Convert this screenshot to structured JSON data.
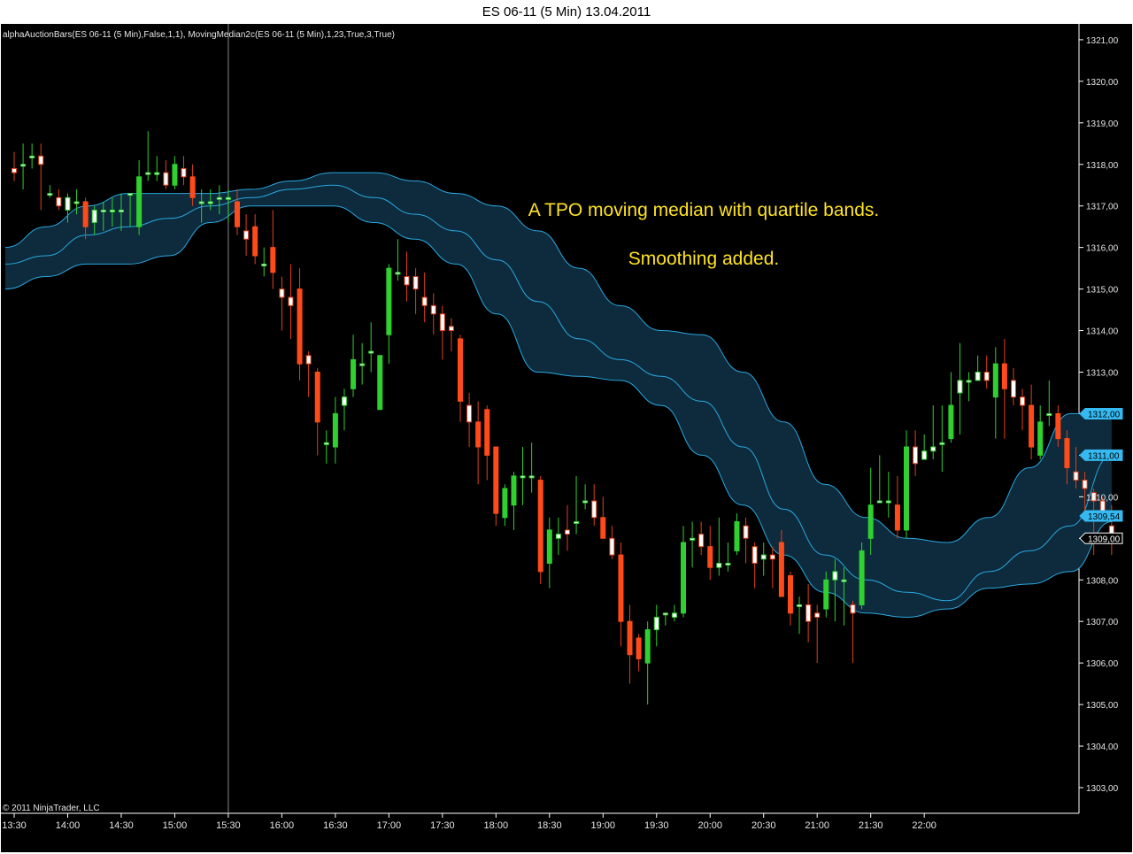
{
  "window": {
    "title": "ES 06-11 (5 Min)  13.04.2011"
  },
  "indicator_label": "alphaAuctionBars(ES 06-11 (5 Min),False,1,1), MovingMedian2c(ES 06-11 (5 Min),1,23,True,3,True)",
  "annotation": {
    "line1": "A TPO moving median with quartile bands.",
    "line2": "Smoothing added."
  },
  "copyright": "© 2011 NinjaTrader, LLC",
  "colors": {
    "background": "#000000",
    "band_fill": "#0d2b3c",
    "band_line": "#29a8e0",
    "up_bar": "#2fd02f",
    "down_bar": "#ff4a1a",
    "wick_up": "#2fd02f",
    "wick_down": "#e0401a",
    "text": "#e6e6e6",
    "annotation": "#ffe21f",
    "marker": "#35b9f0"
  },
  "chart_data": {
    "type": "candlestick",
    "x_ticks": [
      "13:30",
      "14:00",
      "14:30",
      "15:00",
      "15:30",
      "16:00",
      "16:30",
      "17:00",
      "17:30",
      "18:00",
      "18:30",
      "19:00",
      "19:30",
      "20:00",
      "20:30",
      "21:00",
      "21:30",
      "22:00"
    ],
    "y_ticks": [
      "1303,00",
      "1304,00",
      "1305,00",
      "1306,00",
      "1307,00",
      "1308,00",
      "1309,00",
      "1310,00",
      "1311,00",
      "1312,00",
      "1313,00",
      "1314,00",
      "1315,00",
      "1316,00",
      "1317,00",
      "1318,00",
      "1319,00",
      "1320,00",
      "1321,00"
    ],
    "y_tick_values": [
      1303,
      1304,
      1305,
      1306,
      1307,
      1308,
      1309,
      1310,
      1311,
      1312,
      1313,
      1314,
      1315,
      1316,
      1317,
      1318,
      1319,
      1320,
      1321
    ],
    "ylim": [
      1302.5,
      1321.2
    ],
    "bars_per_30min": 6,
    "candles": [
      {
        "o": 1317.9,
        "h": 1318.3,
        "l": 1317.6,
        "c": 1317.8
      },
      {
        "o": 1318.0,
        "h": 1318.5,
        "l": 1317.4,
        "c": 1318.0
      },
      {
        "o": 1318.2,
        "h": 1318.5,
        "l": 1317.9,
        "c": 1318.2
      },
      {
        "o": 1318.2,
        "h": 1318.5,
        "l": 1316.9,
        "c": 1318.0
      },
      {
        "o": 1317.3,
        "h": 1317.5,
        "l": 1317.2,
        "c": 1317.3
      },
      {
        "o": 1317.2,
        "h": 1317.4,
        "l": 1316.9,
        "c": 1317.0
      },
      {
        "o": 1316.9,
        "h": 1317.3,
        "l": 1316.6,
        "c": 1317.2
      },
      {
        "o": 1317.1,
        "h": 1317.4,
        "l": 1316.8,
        "c": 1317.1
      },
      {
        "o": 1317.1,
        "h": 1317.2,
        "l": 1316.2,
        "c": 1316.5
      },
      {
        "o": 1316.6,
        "h": 1317.0,
        "l": 1316.3,
        "c": 1316.9
      },
      {
        "o": 1316.9,
        "h": 1317.1,
        "l": 1316.4,
        "c": 1316.9
      },
      {
        "o": 1316.9,
        "h": 1317.2,
        "l": 1316.5,
        "c": 1316.9
      },
      {
        "o": 1316.9,
        "h": 1317.3,
        "l": 1316.4,
        "c": 1316.9
      },
      {
        "o": 1317.3,
        "h": 1317.3,
        "l": 1316.5,
        "c": 1317.3
      },
      {
        "o": 1316.5,
        "h": 1318.1,
        "l": 1316.3,
        "c": 1317.7
      },
      {
        "o": 1317.8,
        "h": 1318.8,
        "l": 1317.6,
        "c": 1317.8
      },
      {
        "o": 1317.8,
        "h": 1318.2,
        "l": 1317.6,
        "c": 1317.8
      },
      {
        "o": 1317.8,
        "h": 1318.1,
        "l": 1317.4,
        "c": 1317.5
      },
      {
        "o": 1317.5,
        "h": 1318.2,
        "l": 1317.4,
        "c": 1318.0
      },
      {
        "o": 1317.9,
        "h": 1318.2,
        "l": 1317.5,
        "c": 1317.7
      },
      {
        "o": 1317.7,
        "h": 1318.0,
        "l": 1317.0,
        "c": 1317.2
      },
      {
        "o": 1317.1,
        "h": 1317.4,
        "l": 1316.6,
        "c": 1317.1
      },
      {
        "o": 1317.1,
        "h": 1317.4,
        "l": 1316.9,
        "c": 1317.1
      },
      {
        "o": 1317.2,
        "h": 1317.5,
        "l": 1316.8,
        "c": 1317.2
      },
      {
        "o": 1317.2,
        "h": 1317.4,
        "l": 1316.6,
        "c": 1317.2
      },
      {
        "o": 1317.1,
        "h": 1317.4,
        "l": 1316.3,
        "c": 1316.5
      },
      {
        "o": 1316.4,
        "h": 1316.8,
        "l": 1315.8,
        "c": 1316.2
      },
      {
        "o": 1316.5,
        "h": 1316.8,
        "l": 1315.6,
        "c": 1315.8
      },
      {
        "o": 1315.6,
        "h": 1316.0,
        "l": 1315.3,
        "c": 1315.6
      },
      {
        "o": 1316.0,
        "h": 1316.9,
        "l": 1315.0,
        "c": 1315.4
      },
      {
        "o": 1315.0,
        "h": 1315.3,
        "l": 1314.0,
        "c": 1314.8
      },
      {
        "o": 1314.8,
        "h": 1315.6,
        "l": 1313.8,
        "c": 1314.6
      },
      {
        "o": 1315.0,
        "h": 1315.5,
        "l": 1312.8,
        "c": 1313.2
      },
      {
        "o": 1313.4,
        "h": 1313.5,
        "l": 1312.4,
        "c": 1313.2
      },
      {
        "o": 1313.0,
        "h": 1313.1,
        "l": 1311.0,
        "c": 1311.8
      },
      {
        "o": 1311.3,
        "h": 1311.6,
        "l": 1310.8,
        "c": 1311.3
      },
      {
        "o": 1311.2,
        "h": 1312.4,
        "l": 1310.8,
        "c": 1312.0
      },
      {
        "o": 1312.2,
        "h": 1312.6,
        "l": 1311.6,
        "c": 1312.4
      },
      {
        "o": 1312.6,
        "h": 1313.9,
        "l": 1312.4,
        "c": 1313.3
      },
      {
        "o": 1313.2,
        "h": 1313.7,
        "l": 1312.7,
        "c": 1313.2
      },
      {
        "o": 1313.5,
        "h": 1314.2,
        "l": 1313.0,
        "c": 1313.5
      },
      {
        "o": 1312.1,
        "h": 1313.4,
        "l": 1312.1,
        "c": 1313.4
      },
      {
        "o": 1313.9,
        "h": 1315.6,
        "l": 1313.2,
        "c": 1315.5
      },
      {
        "o": 1315.4,
        "h": 1316.2,
        "l": 1315.2,
        "c": 1315.4
      },
      {
        "o": 1315.3,
        "h": 1315.9,
        "l": 1314.7,
        "c": 1315.1
      },
      {
        "o": 1315.3,
        "h": 1315.5,
        "l": 1314.4,
        "c": 1315.0
      },
      {
        "o": 1314.8,
        "h": 1315.4,
        "l": 1314.2,
        "c": 1314.6
      },
      {
        "o": 1314.6,
        "h": 1314.9,
        "l": 1313.9,
        "c": 1314.4
      },
      {
        "o": 1314.4,
        "h": 1314.6,
        "l": 1313.3,
        "c": 1314.0
      },
      {
        "o": 1314.1,
        "h": 1314.3,
        "l": 1313.5,
        "c": 1314.0
      },
      {
        "o": 1313.8,
        "h": 1313.9,
        "l": 1311.8,
        "c": 1312.3
      },
      {
        "o": 1312.2,
        "h": 1312.5,
        "l": 1311.2,
        "c": 1311.8
      },
      {
        "o": 1311.8,
        "h": 1312.3,
        "l": 1310.3,
        "c": 1311.2
      },
      {
        "o": 1312.1,
        "h": 1312.2,
        "l": 1310.4,
        "c": 1311.0
      },
      {
        "o": 1311.2,
        "h": 1311.2,
        "l": 1309.3,
        "c": 1309.6
      },
      {
        "o": 1309.5,
        "h": 1310.3,
        "l": 1309.3,
        "c": 1310.2
      },
      {
        "o": 1309.8,
        "h": 1310.6,
        "l": 1309.2,
        "c": 1310.5
      },
      {
        "o": 1310.5,
        "h": 1311.2,
        "l": 1309.8,
        "c": 1310.5
      },
      {
        "o": 1310.5,
        "h": 1311.3,
        "l": 1310.1,
        "c": 1310.5
      },
      {
        "o": 1310.4,
        "h": 1310.5,
        "l": 1307.9,
        "c": 1308.2
      },
      {
        "o": 1308.4,
        "h": 1309.5,
        "l": 1307.8,
        "c": 1309.2
      },
      {
        "o": 1309.0,
        "h": 1309.5,
        "l": 1308.6,
        "c": 1309.1
      },
      {
        "o": 1309.2,
        "h": 1309.8,
        "l": 1308.7,
        "c": 1309.1
      },
      {
        "o": 1309.4,
        "h": 1310.5,
        "l": 1309.1,
        "c": 1309.4
      },
      {
        "o": 1309.9,
        "h": 1310.3,
        "l": 1309.7,
        "c": 1309.9
      },
      {
        "o": 1309.9,
        "h": 1310.3,
        "l": 1309.3,
        "c": 1309.5
      },
      {
        "o": 1309.5,
        "h": 1310.0,
        "l": 1309.0,
        "c": 1309.0
      },
      {
        "o": 1309.0,
        "h": 1309.3,
        "l": 1308.5,
        "c": 1308.6
      },
      {
        "o": 1308.6,
        "h": 1308.9,
        "l": 1306.4,
        "c": 1307.0
      },
      {
        "o": 1307.0,
        "h": 1307.4,
        "l": 1305.5,
        "c": 1306.2
      },
      {
        "o": 1306.6,
        "h": 1306.7,
        "l": 1305.8,
        "c": 1306.1
      },
      {
        "o": 1306.0,
        "h": 1307.0,
        "l": 1305.0,
        "c": 1306.8
      },
      {
        "o": 1306.8,
        "h": 1307.4,
        "l": 1306.4,
        "c": 1307.1
      },
      {
        "o": 1307.2,
        "h": 1307.2,
        "l": 1306.9,
        "c": 1307.2
      },
      {
        "o": 1307.1,
        "h": 1307.4,
        "l": 1307.0,
        "c": 1307.2
      },
      {
        "o": 1307.2,
        "h": 1309.3,
        "l": 1307.1,
        "c": 1308.9
      },
      {
        "o": 1309.0,
        "h": 1309.4,
        "l": 1308.3,
        "c": 1309.0
      },
      {
        "o": 1309.1,
        "h": 1309.4,
        "l": 1308.6,
        "c": 1308.8
      },
      {
        "o": 1308.8,
        "h": 1309.3,
        "l": 1308.0,
        "c": 1308.3
      },
      {
        "o": 1308.3,
        "h": 1309.5,
        "l": 1308.1,
        "c": 1308.4
      },
      {
        "o": 1308.4,
        "h": 1308.9,
        "l": 1308.2,
        "c": 1308.4
      },
      {
        "o": 1308.7,
        "h": 1309.6,
        "l": 1308.6,
        "c": 1309.4
      },
      {
        "o": 1309.3,
        "h": 1309.5,
        "l": 1308.4,
        "c": 1309.0
      },
      {
        "o": 1308.8,
        "h": 1308.9,
        "l": 1307.8,
        "c": 1308.4
      },
      {
        "o": 1308.5,
        "h": 1308.9,
        "l": 1308.1,
        "c": 1308.6
      },
      {
        "o": 1308.6,
        "h": 1308.8,
        "l": 1307.8,
        "c": 1308.5
      },
      {
        "o": 1308.9,
        "h": 1309.2,
        "l": 1307.7,
        "c": 1307.6
      },
      {
        "o": 1308.1,
        "h": 1308.2,
        "l": 1306.9,
        "c": 1307.2
      },
      {
        "o": 1307.4,
        "h": 1307.6,
        "l": 1306.7,
        "c": 1307.4
      },
      {
        "o": 1307.4,
        "h": 1307.9,
        "l": 1306.5,
        "c": 1307.0
      },
      {
        "o": 1307.2,
        "h": 1307.4,
        "l": 1306.0,
        "c": 1307.1
      },
      {
        "o": 1307.3,
        "h": 1308.2,
        "l": 1307.1,
        "c": 1308.0
      },
      {
        "o": 1308.0,
        "h": 1308.5,
        "l": 1307.0,
        "c": 1308.2
      },
      {
        "o": 1308.0,
        "h": 1308.3,
        "l": 1306.9,
        "c": 1308.0
      },
      {
        "o": 1307.4,
        "h": 1307.5,
        "l": 1306.0,
        "c": 1307.2
      },
      {
        "o": 1307.4,
        "h": 1308.9,
        "l": 1307.3,
        "c": 1308.7
      },
      {
        "o": 1309.0,
        "h": 1310.7,
        "l": 1308.6,
        "c": 1309.8
      },
      {
        "o": 1309.9,
        "h": 1311.0,
        "l": 1309.9,
        "c": 1309.9
      },
      {
        "o": 1309.9,
        "h": 1310.6,
        "l": 1309.5,
        "c": 1309.9
      },
      {
        "o": 1309.8,
        "h": 1310.5,
        "l": 1309.0,
        "c": 1309.2
      },
      {
        "o": 1309.2,
        "h": 1311.6,
        "l": 1309.0,
        "c": 1311.2
      },
      {
        "o": 1311.2,
        "h": 1311.6,
        "l": 1310.5,
        "c": 1310.8
      },
      {
        "o": 1310.9,
        "h": 1311.5,
        "l": 1310.9,
        "c": 1311.1
      },
      {
        "o": 1311.1,
        "h": 1312.2,
        "l": 1310.9,
        "c": 1311.2
      },
      {
        "o": 1311.3,
        "h": 1312.2,
        "l": 1310.6,
        "c": 1311.3
      },
      {
        "o": 1311.4,
        "h": 1313.0,
        "l": 1311.3,
        "c": 1312.2
      },
      {
        "o": 1312.5,
        "h": 1313.7,
        "l": 1311.5,
        "c": 1312.8
      },
      {
        "o": 1312.8,
        "h": 1313.0,
        "l": 1312.3,
        "c": 1312.8
      },
      {
        "o": 1312.8,
        "h": 1313.4,
        "l": 1312.8,
        "c": 1313.0
      },
      {
        "o": 1313.0,
        "h": 1313.4,
        "l": 1312.6,
        "c": 1312.8
      },
      {
        "o": 1312.4,
        "h": 1313.6,
        "l": 1311.4,
        "c": 1313.2
      },
      {
        "o": 1313.2,
        "h": 1313.8,
        "l": 1311.4,
        "c": 1312.6
      },
      {
        "o": 1312.8,
        "h": 1313.1,
        "l": 1312.2,
        "c": 1312.4
      },
      {
        "o": 1312.4,
        "h": 1312.6,
        "l": 1311.6,
        "c": 1312.2
      },
      {
        "o": 1312.2,
        "h": 1312.7,
        "l": 1310.9,
        "c": 1311.2
      },
      {
        "o": 1311.0,
        "h": 1312.2,
        "l": 1310.9,
        "c": 1311.8
      },
      {
        "o": 1312.0,
        "h": 1312.8,
        "l": 1311.7,
        "c": 1312.0
      },
      {
        "o": 1312.0,
        "h": 1312.2,
        "l": 1311.2,
        "c": 1311.4
      },
      {
        "o": 1311.4,
        "h": 1311.6,
        "l": 1310.3,
        "c": 1310.7
      },
      {
        "o": 1310.6,
        "h": 1311.2,
        "l": 1310.2,
        "c": 1310.4
      },
      {
        "o": 1310.4,
        "h": 1310.6,
        "l": 1309.5,
        "c": 1310.2
      },
      {
        "o": 1310.1,
        "h": 1310.2,
        "l": 1308.6,
        "c": 1309.9
      },
      {
        "o": 1309.9,
        "h": 1310.0,
        "l": 1309.4,
        "c": 1309.6
      },
      {
        "o": 1309.3,
        "h": 1309.8,
        "l": 1308.6,
        "c": 1309.1
      }
    ],
    "bands": {
      "upper": [
        1316.0,
        1316.5,
        1317.0,
        1317.3,
        1317.3,
        1317.3,
        1317.4,
        1317.6,
        1317.8,
        1317.8,
        1317.6,
        1317.3,
        1317.0,
        1316.4,
        1315.5,
        1314.6,
        1314.0,
        1313.9,
        1313.0,
        1311.8,
        1310.3,
        1309.5,
        1309.0,
        1308.9,
        1309.5,
        1310.7,
        1312.0,
        1312.0
      ],
      "median": [
        1315.6,
        1315.8,
        1316.3,
        1316.5,
        1316.7,
        1317.0,
        1317.2,
        1317.4,
        1317.5,
        1317.2,
        1316.8,
        1316.4,
        1315.7,
        1314.7,
        1313.8,
        1313.3,
        1312.9,
        1312.3,
        1311.2,
        1309.7,
        1308.6,
        1308.0,
        1307.7,
        1307.5,
        1308.2,
        1308.7,
        1309.3,
        1311.0
      ],
      "lower": [
        1315.0,
        1315.3,
        1315.6,
        1315.6,
        1315.8,
        1316.6,
        1317.0,
        1317.0,
        1317.0,
        1316.6,
        1316.2,
        1315.6,
        1314.4,
        1313.0,
        1312.9,
        1312.8,
        1312.2,
        1311.0,
        1309.8,
        1308.6,
        1307.7,
        1307.2,
        1307.1,
        1307.3,
        1307.8,
        1307.9,
        1308.2,
        1309.4
      ]
    },
    "price_markers": [
      {
        "label": "1312,00",
        "value": 1312.0,
        "style": "band"
      },
      {
        "label": "1311,00",
        "value": 1311.0,
        "style": "band"
      },
      {
        "label": "1309,54",
        "value": 1309.54,
        "style": "band"
      },
      {
        "label": "1309,00",
        "value": 1309.0,
        "style": "last"
      }
    ],
    "crosshair_time": "15:30"
  }
}
